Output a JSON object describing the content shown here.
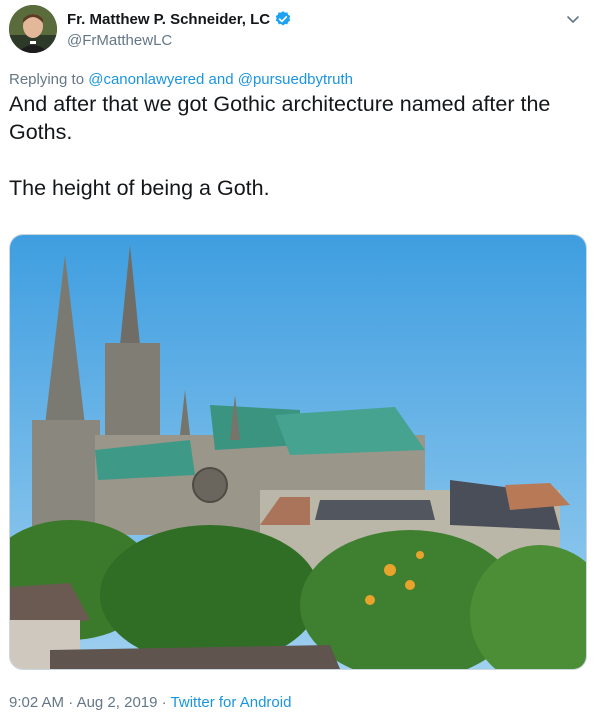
{
  "author": {
    "display_name": "Fr. Matthew P. Schneider, LC",
    "handle": "@FrMatthewLC"
  },
  "reply": {
    "prefix": "Replying to",
    "users": [
      "@canonlawyered",
      "@pursuedbytruth"
    ],
    "joiner": "and"
  },
  "tweet": {
    "line1": "And after that we got Gothic architecture named after the Goths.",
    "line2": "The height of being a Goth."
  },
  "media": {
    "subject": "Gothic cathedral with two spires and green copper roof behind trees"
  },
  "meta": {
    "time": "9:02 AM",
    "separator": "·",
    "date": "Aug 2, 2019",
    "source": "Twitter for Android"
  },
  "colors": {
    "link": "#1b95e0",
    "muted": "#657786",
    "text": "#14171a",
    "verified": "#1da1f2"
  },
  "icons": [
    "verified-badge-icon",
    "chevron-down-icon"
  ]
}
